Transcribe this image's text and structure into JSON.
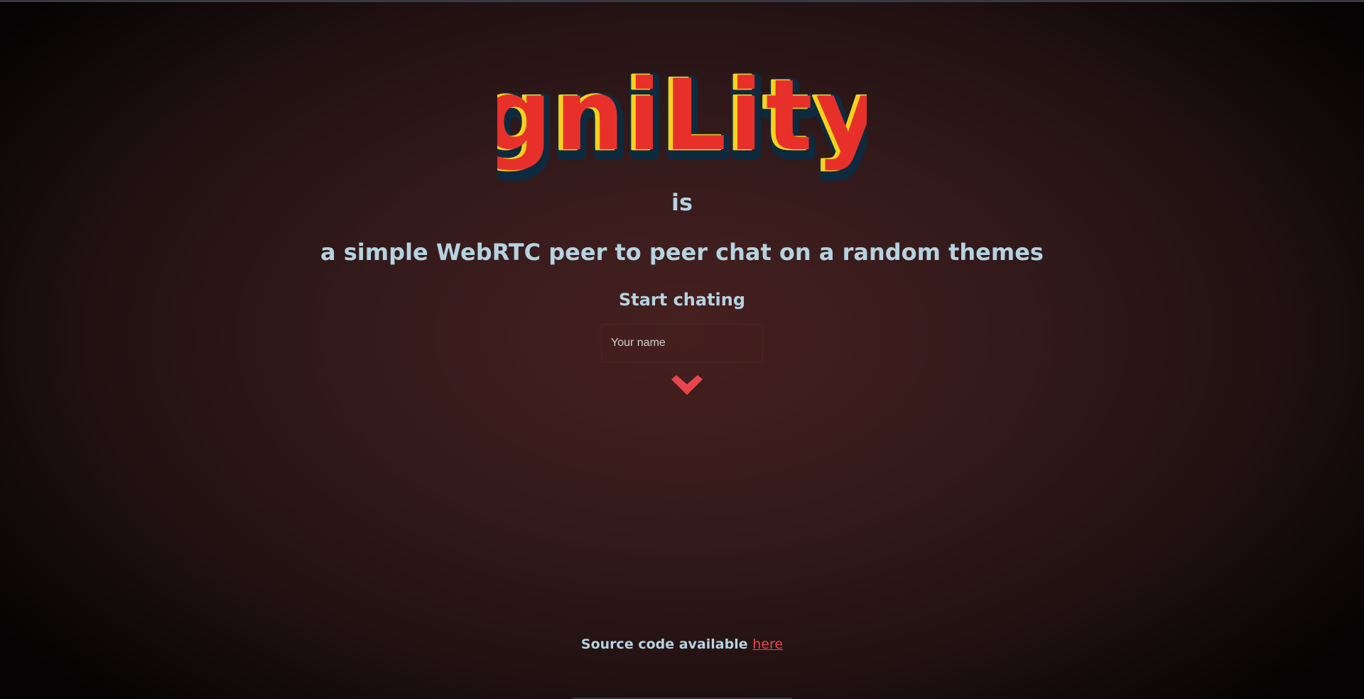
{
  "logo": {
    "text": "gniLity",
    "colors": {
      "fill": "#e8302b",
      "highlight": "#f5d21c",
      "outline": "#0e2a3e"
    }
  },
  "intro": {
    "is": "is",
    "tagline": "a simple WebRTC peer to peer chat on a random themes",
    "start": "Start chating"
  },
  "name_input": {
    "placeholder": "Your name",
    "value": ""
  },
  "submit": {
    "icon": "chevron-down-icon",
    "color": "#e8454d"
  },
  "footer": {
    "prefix": "Source code available",
    "link": "here"
  },
  "theme": {
    "text": "#b5d3e0",
    "accent": "#e8454d",
    "background": "#3a1b1c"
  }
}
